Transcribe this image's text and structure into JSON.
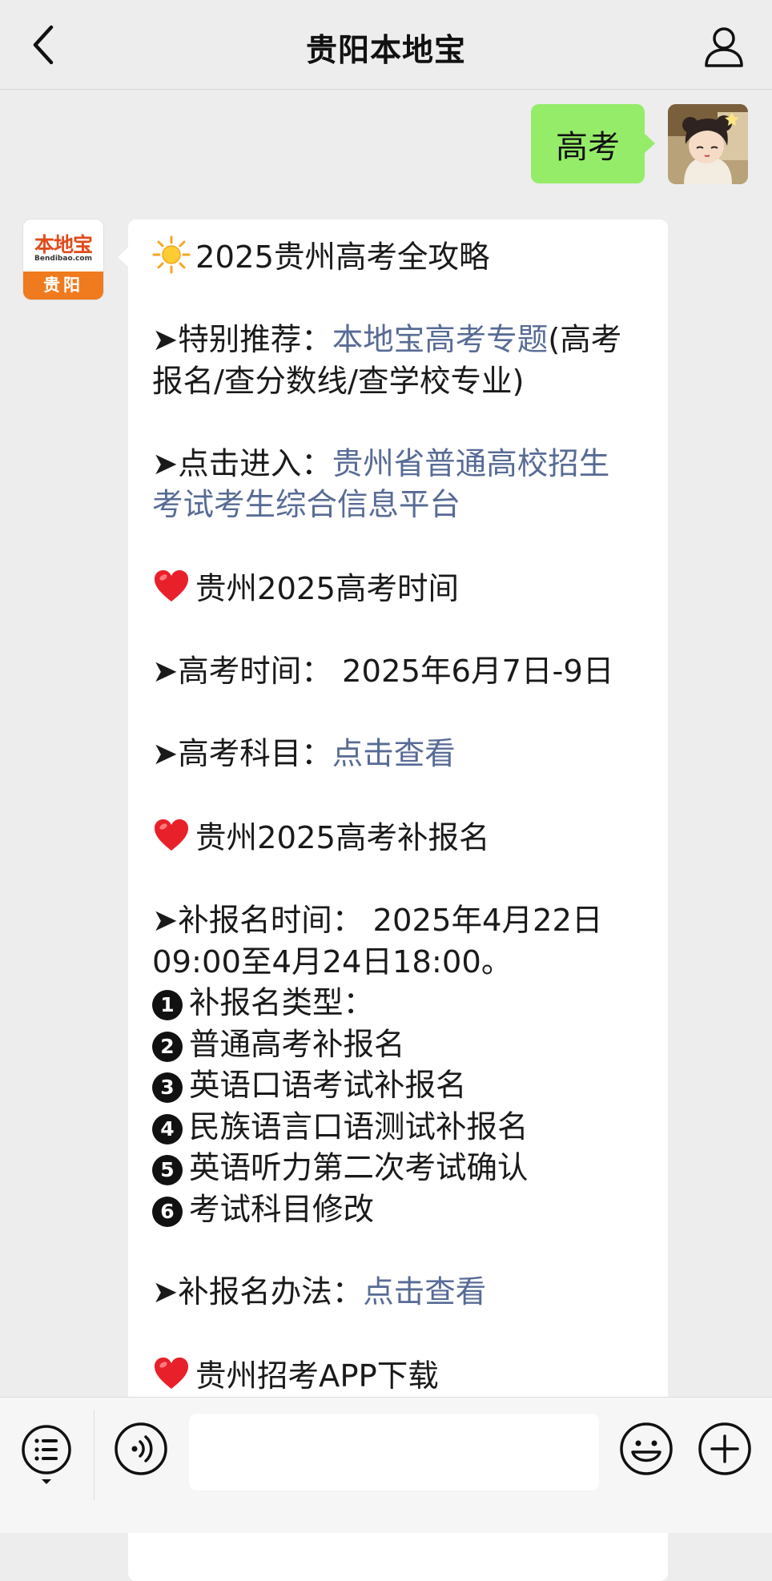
{
  "nav": {
    "title": "贵阳本地宝"
  },
  "outgoing": {
    "text": "高考"
  },
  "bot_avatar": {
    "logo_main": "本地宝",
    "logo_sub": "Bendibao.com",
    "logo_city": "贵阳"
  },
  "message": {
    "heading": "2025贵州高考全攻略",
    "rec_prefix": "➤特别推荐：",
    "rec_link": "本地宝高考专题",
    "rec_suffix_1": "(高考",
    "rec_suffix_2": "报名/查分数线/查学校专业)",
    "enter_prefix": "➤点击进入：",
    "enter_link_1": "贵州省普通高校招生",
    "enter_link_2": "考试考生综合信息平台",
    "sec1_title": "贵州2025高考时间",
    "exam_time": "➤高考时间：  2025年6月7日-9日",
    "subjects_prefix": "➤高考科目：",
    "subjects_link": "点击查看",
    "sec2_title": "贵州2025高考补报名",
    "supp_time_1": "➤补报名时间：  2025年4月22日",
    "supp_time_2": "09:00至4月24日18:00。",
    "list": [
      {
        "num": "1",
        "text": "补报名类型："
      },
      {
        "num": "2",
        "text": "普通高考补报名"
      },
      {
        "num": "3",
        "text": "英语口语考试补报名"
      },
      {
        "num": "4",
        "text": "民族语言口语测试补报名"
      },
      {
        "num": "5",
        "text": "英语听力第二次考试确认"
      },
      {
        "num": "6",
        "text": "考试科目修改"
      }
    ],
    "method_prefix": "➤补报名办法：",
    "method_link": "点击查看",
    "sec3_title": "贵州招考APP下载"
  },
  "input": {
    "value": "",
    "placeholder": ""
  },
  "colors": {
    "link": "#576b95",
    "outgoing_bubble": "#95ec69",
    "background": "#ededed"
  },
  "icons": {
    "back": "chevron-left-icon",
    "user": "user-icon",
    "menu": "list-menu-icon",
    "voice": "voice-icon",
    "emoji": "smiley-icon",
    "plus": "plus-icon"
  }
}
